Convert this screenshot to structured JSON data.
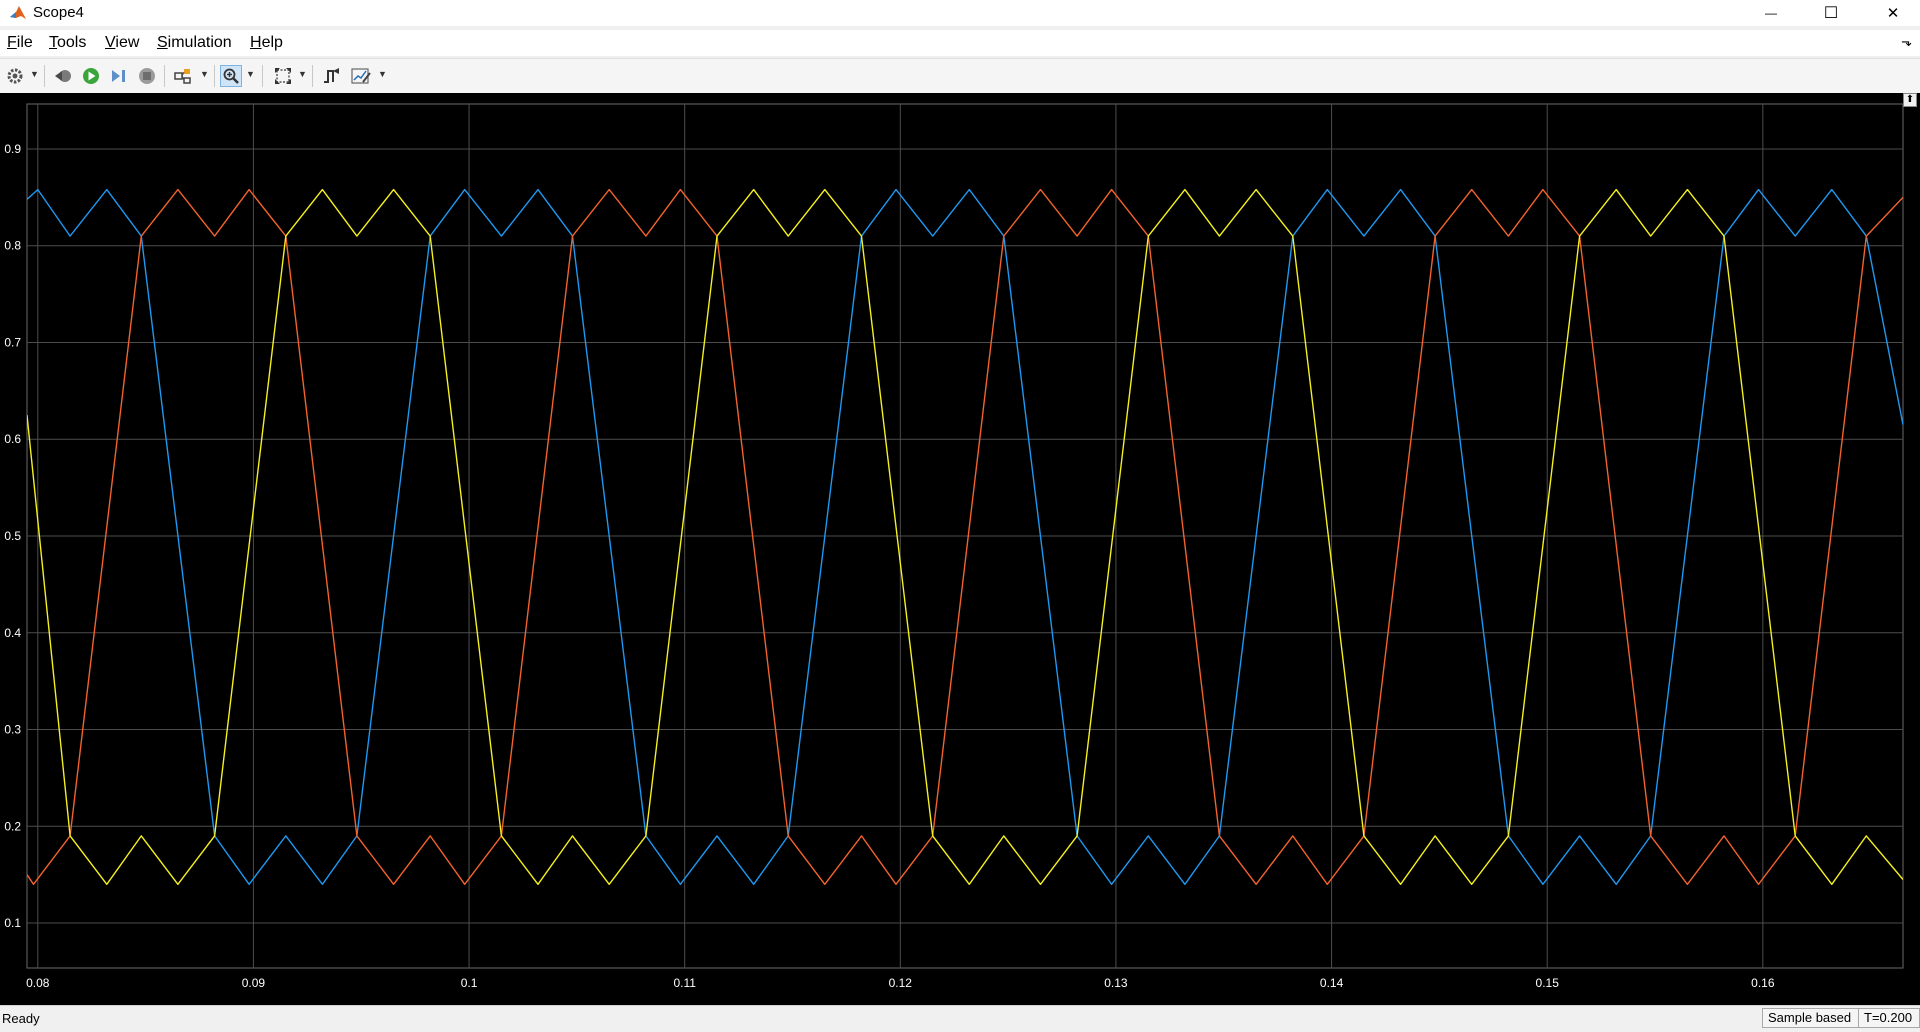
{
  "window": {
    "title": "Scope4",
    "minimize_glyph": "—",
    "maximize_glyph": "☐",
    "close_glyph": "✕"
  },
  "menu": {
    "items": [
      {
        "label": "File",
        "accel": "F",
        "rest": "ile"
      },
      {
        "label": "Tools",
        "accel": "T",
        "rest": "ools"
      },
      {
        "label": "View",
        "accel": "V",
        "rest": "iew"
      },
      {
        "label": "Simulation",
        "accel": "S",
        "rest": "imulation"
      },
      {
        "label": "Help",
        "accel": "H",
        "rest": "elp"
      }
    ],
    "dock_glyph": "⬎"
  },
  "toolbar": {
    "icons": [
      "settings-gear-icon",
      "step-back-icon",
      "run-icon",
      "step-forward-icon",
      "stop-icon",
      "highlight-simulink-block-icon",
      "zoom-in-icon",
      "scale-axes-icon",
      "triggers-icon",
      "measurements-icon"
    ]
  },
  "status": {
    "left": "Ready",
    "sample_mode": "Sample based",
    "time": "T=0.200"
  },
  "colors": {
    "background": "#000000",
    "grid": "#4d4d4d",
    "tick_text": "#ffffff",
    "series_blue": "#1e98f0",
    "series_orange": "#f2622e",
    "series_yellow": "#f5f020"
  },
  "chart_data": {
    "type": "line",
    "title": "",
    "xlabel": "",
    "ylabel": "",
    "xlim": [
      0.0795,
      0.1665
    ],
    "ylim": [
      0.0535,
      0.9465
    ],
    "xticks": [
      0.08,
      0.09,
      0.1,
      0.11,
      0.12,
      0.13,
      0.14,
      0.15,
      0.16
    ],
    "xtick_labels": [
      "0.08",
      "0.09",
      "0.1",
      "0.11",
      "0.12",
      "0.13",
      "0.14",
      "0.15",
      "0.16"
    ],
    "yticks": [
      0.1,
      0.2,
      0.3,
      0.4,
      0.5,
      0.6,
      0.7,
      0.8,
      0.9
    ],
    "ytick_labels": [
      "0.1",
      "0.2",
      "0.3",
      "0.4",
      "0.5",
      "0.6",
      "0.7",
      "0.8",
      "0.9"
    ],
    "grid": true,
    "legend": "none",
    "series": [
      {
        "color": "#1e98f0",
        "x": [
          0.0795,
          0.08,
          0.0815,
          0.0832,
          0.0848,
          0.0882,
          0.0898,
          0.0915,
          0.0932,
          0.0948,
          0.0982,
          0.0998,
          0.1015,
          0.1032,
          0.1048,
          0.1082,
          0.1098,
          0.1115,
          0.1132,
          0.1148,
          0.1182,
          0.1198,
          0.1215,
          0.1232,
          0.1248,
          0.1282,
          0.1298,
          0.1315,
          0.1332,
          0.1348,
          0.1382,
          0.1398,
          0.1415,
          0.1432,
          0.1448,
          0.1482,
          0.1498,
          0.1515,
          0.1532,
          0.1548,
          0.1582,
          0.1598,
          0.1615,
          0.1632,
          0.1648,
          0.1665
        ],
        "y": [
          0.848,
          0.858,
          0.81,
          0.858,
          0.81,
          0.19,
          0.14,
          0.19,
          0.14,
          0.19,
          0.81,
          0.858,
          0.81,
          0.858,
          0.81,
          0.19,
          0.14,
          0.19,
          0.14,
          0.19,
          0.81,
          0.858,
          0.81,
          0.858,
          0.81,
          0.19,
          0.14,
          0.19,
          0.14,
          0.19,
          0.81,
          0.858,
          0.81,
          0.858,
          0.81,
          0.19,
          0.14,
          0.19,
          0.14,
          0.19,
          0.81,
          0.858,
          0.81,
          0.858,
          0.81,
          0.615
        ]
      },
      {
        "color": "#f2622e",
        "x": [
          0.0795,
          0.0798,
          0.0815,
          0.0848,
          0.0865,
          0.0882,
          0.0898,
          0.0915,
          0.0948,
          0.0965,
          0.0982,
          0.0998,
          0.1015,
          0.1048,
          0.1065,
          0.1082,
          0.1098,
          0.1115,
          0.1148,
          0.1165,
          0.1182,
          0.1198,
          0.1215,
          0.1248,
          0.1265,
          0.1282,
          0.1298,
          0.1315,
          0.1348,
          0.1365,
          0.1382,
          0.1398,
          0.1415,
          0.1448,
          0.1465,
          0.1482,
          0.1498,
          0.1515,
          0.1548,
          0.1565,
          0.1582,
          0.1598,
          0.1615,
          0.1648,
          0.1665
        ],
        "y": [
          0.15,
          0.14,
          0.19,
          0.81,
          0.858,
          0.81,
          0.858,
          0.81,
          0.19,
          0.14,
          0.19,
          0.14,
          0.19,
          0.81,
          0.858,
          0.81,
          0.858,
          0.81,
          0.19,
          0.14,
          0.19,
          0.14,
          0.19,
          0.81,
          0.858,
          0.81,
          0.858,
          0.81,
          0.19,
          0.14,
          0.19,
          0.14,
          0.19,
          0.81,
          0.858,
          0.81,
          0.858,
          0.81,
          0.19,
          0.14,
          0.19,
          0.14,
          0.19,
          0.81,
          0.85
        ]
      },
      {
        "color": "#f5f020",
        "x": [
          0.0795,
          0.0815,
          0.0832,
          0.0848,
          0.0865,
          0.0882,
          0.0915,
          0.0932,
          0.0948,
          0.0965,
          0.0982,
          0.1015,
          0.1032,
          0.1048,
          0.1065,
          0.1082,
          0.1115,
          0.1132,
          0.1148,
          0.1165,
          0.1182,
          0.1215,
          0.1232,
          0.1248,
          0.1265,
          0.1282,
          0.1315,
          0.1332,
          0.1348,
          0.1365,
          0.1382,
          0.1415,
          0.1432,
          0.1448,
          0.1465,
          0.1482,
          0.1515,
          0.1532,
          0.1548,
          0.1565,
          0.1582,
          0.1615,
          0.1632,
          0.1648,
          0.1665
        ],
        "y": [
          0.625,
          0.19,
          0.14,
          0.19,
          0.14,
          0.19,
          0.81,
          0.858,
          0.81,
          0.858,
          0.81,
          0.19,
          0.14,
          0.19,
          0.14,
          0.19,
          0.81,
          0.858,
          0.81,
          0.858,
          0.81,
          0.19,
          0.14,
          0.19,
          0.14,
          0.19,
          0.81,
          0.858,
          0.81,
          0.858,
          0.81,
          0.19,
          0.14,
          0.19,
          0.14,
          0.19,
          0.81,
          0.858,
          0.81,
          0.858,
          0.81,
          0.19,
          0.14,
          0.19,
          0.145
        ]
      }
    ]
  }
}
